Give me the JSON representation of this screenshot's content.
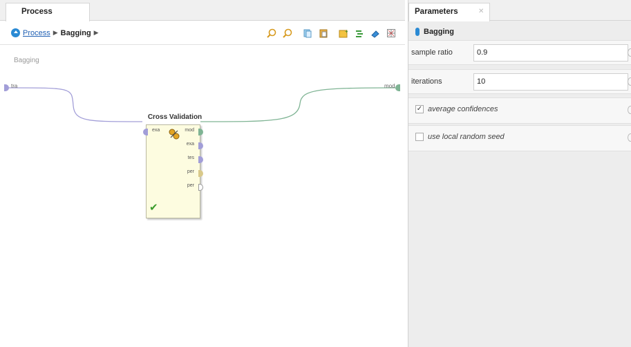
{
  "process_panel": {
    "tab_label": "Process",
    "breadcrumb": {
      "root": "Process",
      "current": "Bagging"
    },
    "toolbar_icons": [
      "zoom-in-icon",
      "zoom-out-icon",
      "copy-icon",
      "paste-icon",
      "add-operator-icon",
      "wire-icon",
      "breakpoint-icon",
      "grid-icon"
    ],
    "canvas_label": "Bagging",
    "left_port": "tra",
    "right_port": "mod"
  },
  "operator": {
    "title": "Cross Validation",
    "input_port": "exa",
    "output_ports": [
      "mod",
      "exa",
      "tes",
      "per",
      "per"
    ],
    "status": "✔"
  },
  "parameters_panel": {
    "tab_label": "Parameters",
    "close_glyph": "✕",
    "operator_name": "Bagging",
    "sample_ratio_label": "sample ratio",
    "sample_ratio_value": "0.9",
    "iterations_label": "iterations",
    "iterations_value": "10",
    "average_confidences_label": "average confidences",
    "average_confidences_checked": true,
    "use_local_random_seed_label": "use local random seed",
    "use_local_random_seed_checked": false
  }
}
